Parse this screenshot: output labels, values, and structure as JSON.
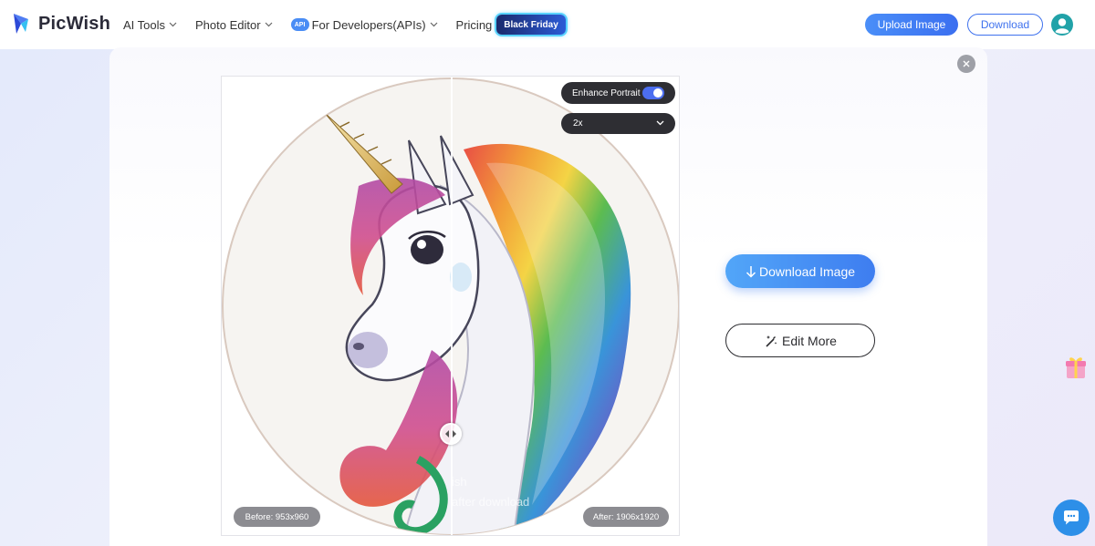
{
  "header": {
    "brand": "PicWish",
    "nav": [
      {
        "label": "AI Tools",
        "has_dropdown": true
      },
      {
        "label": "Photo Editor",
        "has_dropdown": true
      },
      {
        "label": "For Developers(APIs)",
        "has_dropdown": true,
        "badge": "API"
      },
      {
        "label": "Pricing",
        "has_dropdown": false,
        "badge": "Black Friday"
      }
    ],
    "upload_label": "Upload Image",
    "download_label": "Download",
    "avatar_icon": "user-avatar-icon"
  },
  "editor": {
    "enhance_label": "Enhance Portrait",
    "enhance_on": true,
    "scale_value": "2x",
    "before_label": "Before: 953x960",
    "after_label": "After: 1906x1920",
    "watermark_line1": "ish",
    "watermark_line2": "after download"
  },
  "actions": {
    "download_image_label": "Download Image",
    "edit_more_label": "Edit More"
  },
  "colors": {
    "brand_blue": "#3e7df0",
    "dark_control": "#2e2e33",
    "toggle_on": "#4c6ef0"
  }
}
